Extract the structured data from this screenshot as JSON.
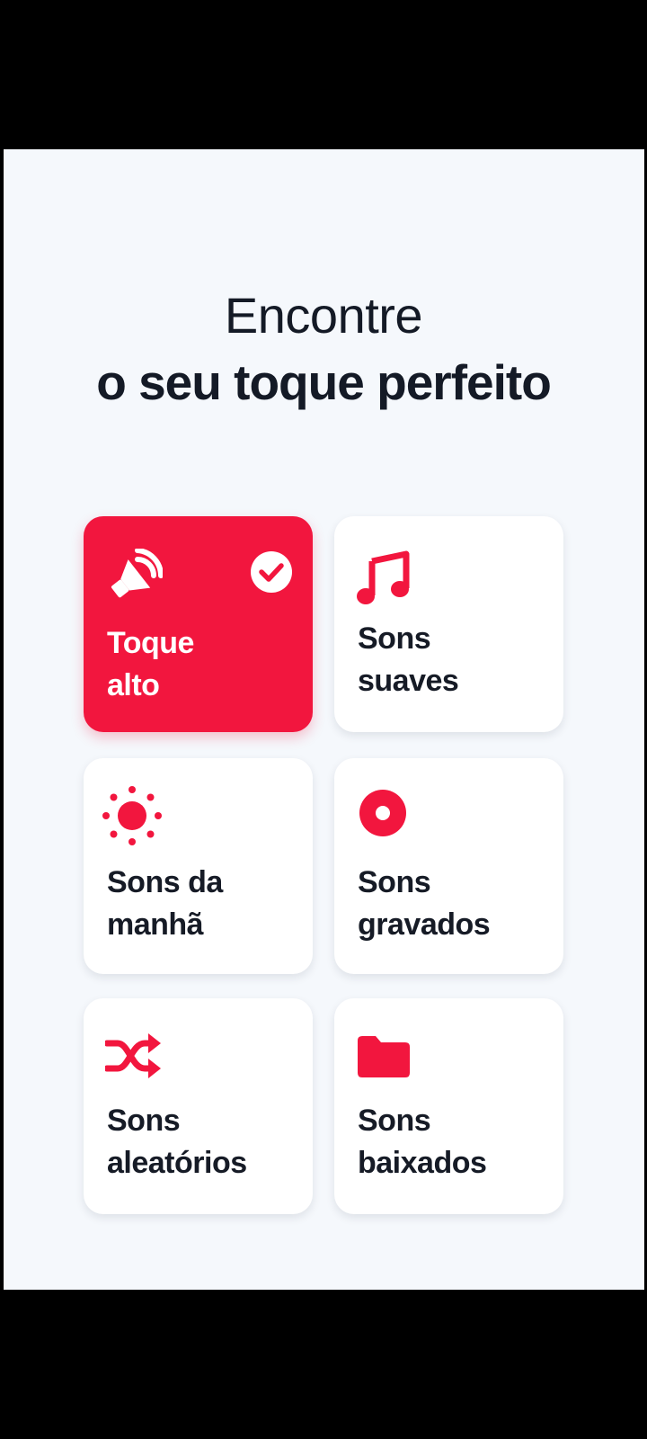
{
  "header": {
    "line1": "Encontre",
    "line2": "o seu toque perfeito"
  },
  "categories": [
    {
      "line1": "Toque",
      "line2": "alto",
      "icon": "loud-speaker-icon",
      "selected": true
    },
    {
      "line1": "Sons",
      "line2": "suaves",
      "icon": "music-note-icon",
      "selected": false
    },
    {
      "line1": "Sons da",
      "line2": "manhã",
      "icon": "sun-icon",
      "selected": false
    },
    {
      "line1": "Sons",
      "line2": "gravados",
      "icon": "record-icon",
      "selected": false
    },
    {
      "line1": "Sons",
      "line2": "aleatórios",
      "icon": "shuffle-icon",
      "selected": false
    },
    {
      "line1": "Sons",
      "line2": "baixados",
      "icon": "folder-icon",
      "selected": false
    }
  ],
  "colors": {
    "accent": "#f2163e",
    "background": "#f5f8fc",
    "text": "#161b26",
    "card": "#ffffff"
  }
}
